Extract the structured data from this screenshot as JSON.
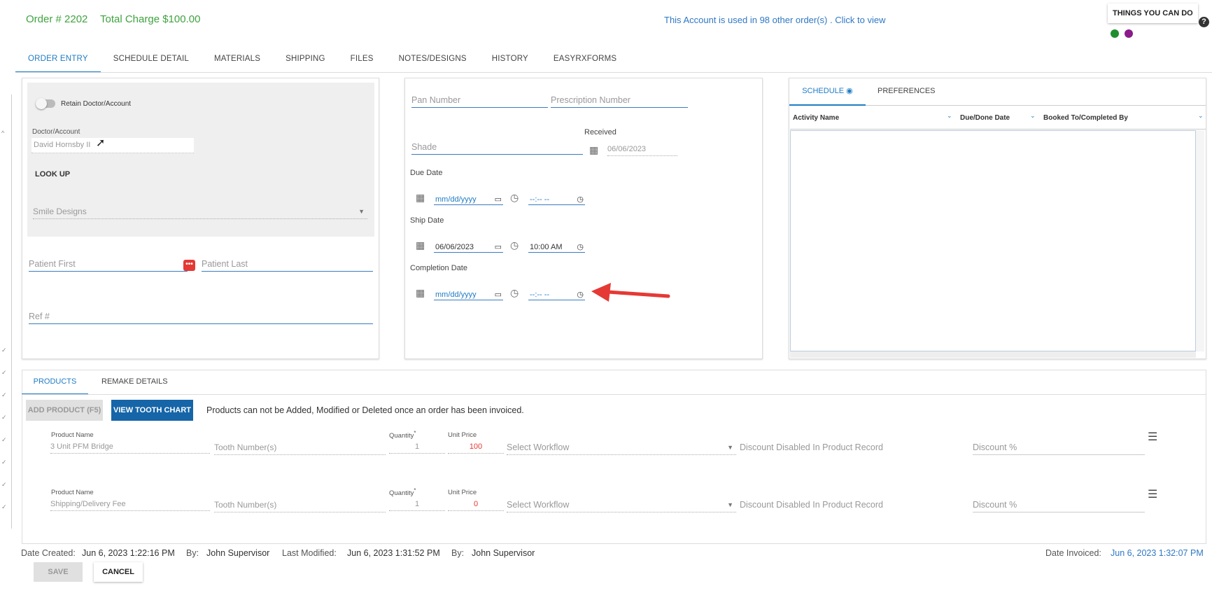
{
  "header": {
    "order_label": "Order # 2202",
    "total_label": "Total Charge $100.00",
    "account_link": "This Account is used in 98 other order(s) . Click to view",
    "things_button": "THINGS YOU CAN DO",
    "help_icon": "?",
    "status_colors": [
      "#1e8f2e",
      "#8b1a8b"
    ]
  },
  "tabs": [
    "ORDER ENTRY",
    "SCHEDULE DETAIL",
    "MATERIALS",
    "SHIPPING",
    "FILES",
    "NOTES/DESIGNS",
    "HISTORY",
    "EASYRXFORMS"
  ],
  "left_panel": {
    "retain_label": "Retain Doctor/Account",
    "doctor_label": "Doctor/Account",
    "doctor_value": "David Hornsby II",
    "lookup_label": "LOOK UP",
    "practice_value": "Smile Designs",
    "patient_first_placeholder": "Patient First",
    "patient_last_placeholder": "Patient Last",
    "ref_placeholder": "Ref #"
  },
  "middle_panel": {
    "pan_placeholder": "Pan Number",
    "rx_placeholder": "Prescription Number",
    "shade_placeholder": "Shade",
    "received_label": "Received",
    "received_value": "06/06/2023",
    "due_label": "Due Date",
    "due_date": "mm/dd/yyyy",
    "due_time": "--:-- --",
    "ship_label": "Ship Date",
    "ship_date": "06/06/2023",
    "ship_time": "10:00 AM",
    "completion_label": "Completion Date",
    "completion_date": "mm/dd/yyyy",
    "completion_time": "--:-- --"
  },
  "right_panel": {
    "tab_schedule": "SCHEDULE",
    "tab_preferences": "PREFERENCES",
    "columns": [
      "Activity Name",
      "Due/Done Date",
      "Booked To/Completed By"
    ]
  },
  "products": {
    "tab_products": "PRODUCTS",
    "tab_remake": "REMAKE DETAILS",
    "add_button": "ADD PRODUCT (F5)",
    "tooth_chart_button": "VIEW TOOTH CHART",
    "notice": "Products can not be Added, Modified or Deleted once an order has been invoiced.",
    "labels": {
      "product_name": "Product Name",
      "quantity": "Quantity",
      "required_mark": "*",
      "unit_price": "Unit Price"
    },
    "rows": [
      {
        "name": "3 Unit PFM Bridge",
        "tooth_placeholder": "Tooth Number(s)",
        "quantity": "1",
        "price": "100",
        "workflow": "Select Workflow",
        "discount_note": "Discount Disabled In Product Record",
        "discount_placeholder": "Discount %"
      },
      {
        "name": "Shipping/Delivery Fee",
        "tooth_placeholder": "Tooth Number(s)",
        "quantity": "1",
        "price": "0",
        "workflow": "Select Workflow",
        "discount_note": "Discount Disabled In Product Record",
        "discount_placeholder": "Discount %"
      }
    ]
  },
  "footer": {
    "created_label": "Date Created:",
    "created_value": "Jun 6, 2023 1:22:16 PM",
    "by_label": "By:",
    "created_by": "John Supervisor",
    "modified_label": "Last Modified:",
    "modified_value": "Jun 6, 2023 1:31:52 PM",
    "modified_by_label": "By:",
    "modified_by": "John Supervisor",
    "invoiced_label": "Date Invoiced:",
    "invoiced_value": "Jun 6, 2023 1:32:07 PM",
    "save_button": "SAVE",
    "cancel_button": "CANCEL"
  },
  "colors": {
    "accent": "#1f7cc4",
    "green": "#3fa33f",
    "red_price": "#e53935",
    "arrow": "#e53935"
  }
}
